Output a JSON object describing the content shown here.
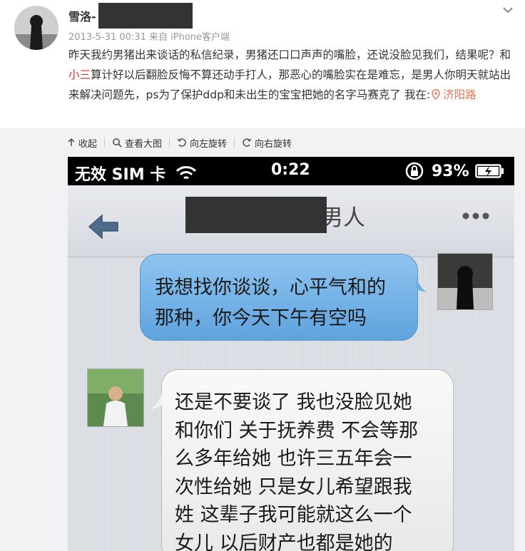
{
  "post": {
    "username": "雪洛-",
    "meta": "2013-5-31 00:31 来自 iPhone客户端",
    "text_part1": "昨天我约男猪出来谈话的私信纪录，男猪还口口声声的嘴脸，还说没脸见我们，结果呢？和",
    "highlight": "小三",
    "text_part2": "算计好以后翻脸反悔不算还动手打人，那恶心的嘴脸实在是难忘，是男人你明天就站出来解决问题先，ps为了保护ddp和未出生的宝宝把她的名字马赛克了 我在:",
    "location": "济阳路"
  },
  "toolbar": {
    "collapse": "收起",
    "view_large": "查看大图",
    "rotate_left": "向左旋转",
    "rotate_right": "向右旋转"
  },
  "phone": {
    "carrier": "无效 SIM 卡",
    "time": "0:22",
    "battery": "93%",
    "nav_title": "男人",
    "msg_out_line1": "我想找你谈谈，心平气和的",
    "msg_out_line2": "那种，你今天下午有空吗",
    "msg_in_lines": [
      "还是不要谈了 我也没脸见她",
      "和你们 关于抚养费 不会等那",
      "么多年给她 也许三五年会一",
      "次性给她 只是女儿希望跟我",
      "姓 这辈子我可能就这么一个",
      "女儿 以后财产也都是她的"
    ]
  },
  "colors": {
    "accent_orange": "#f7931e",
    "highlight_red": "#d9272e",
    "location_orange": "#eb7350",
    "bubble_blue": "#5fa3de"
  }
}
